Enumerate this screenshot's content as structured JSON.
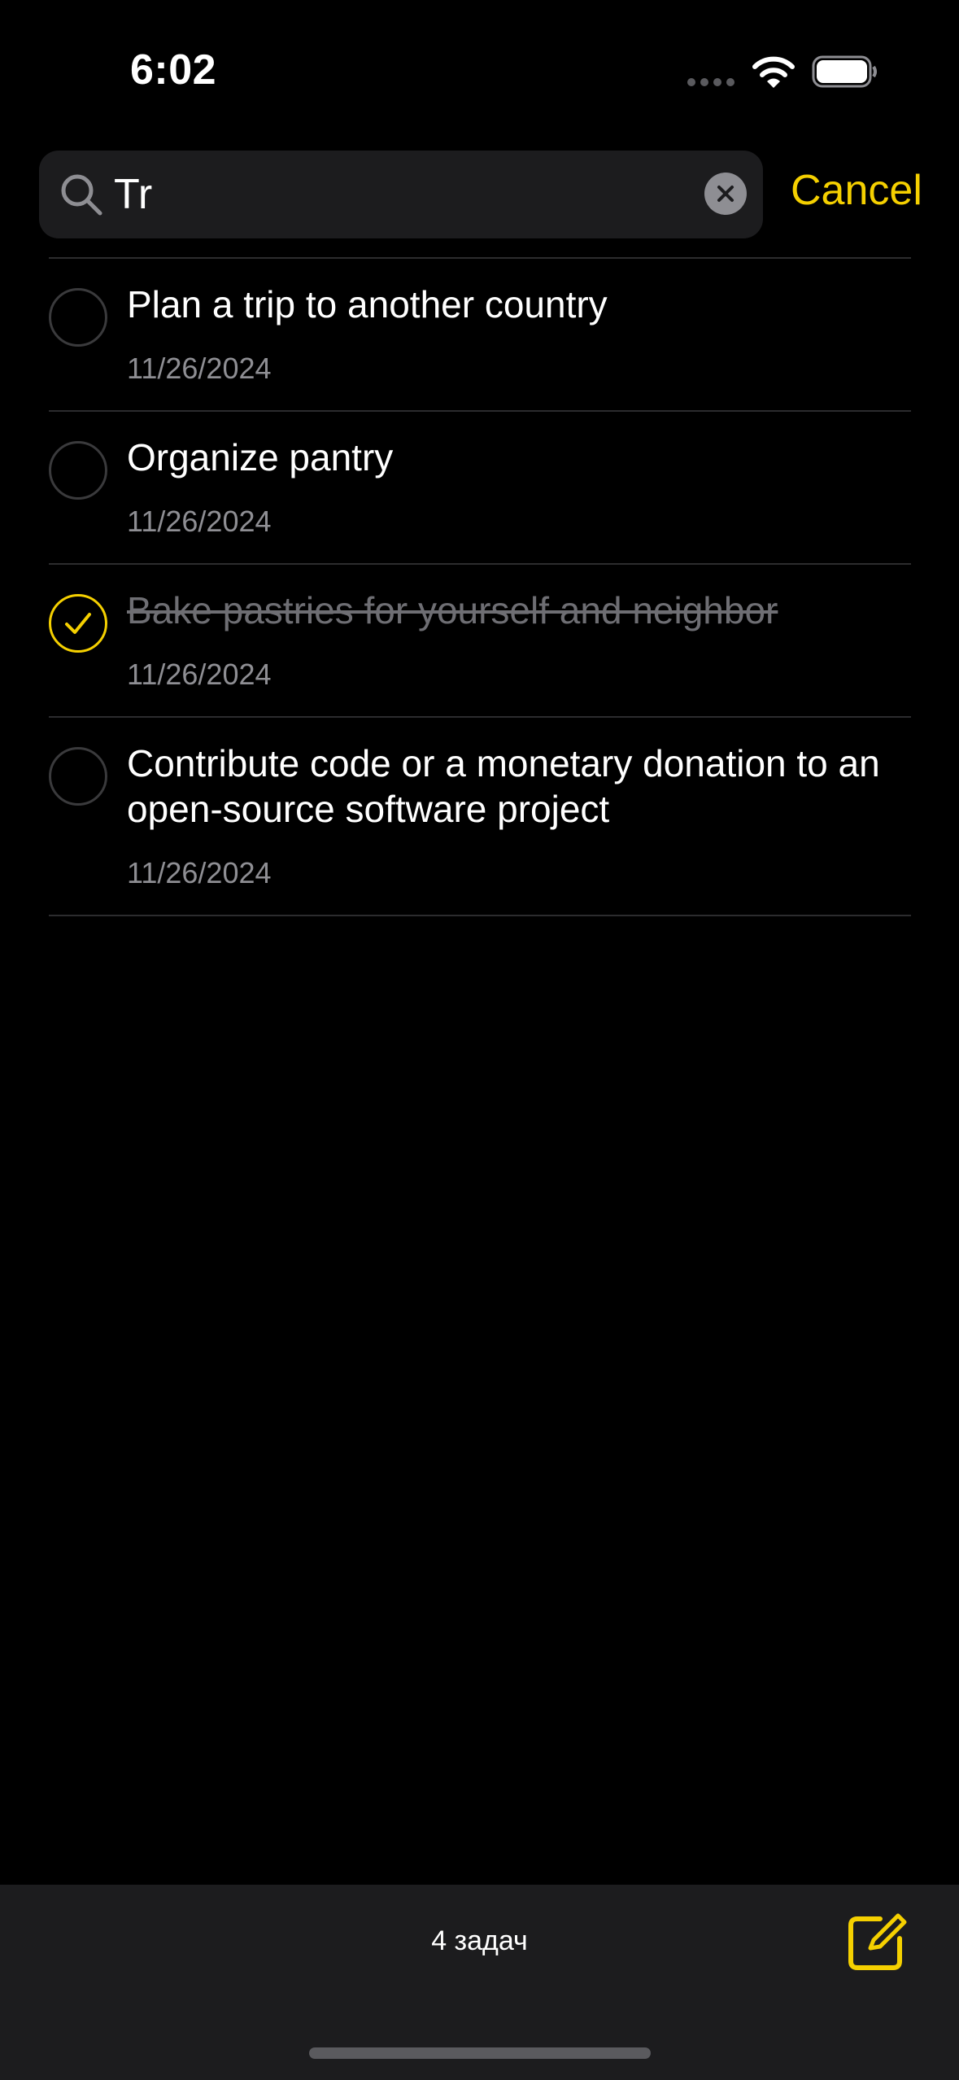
{
  "status_bar": {
    "time": "6:02",
    "icons": [
      "cellular-signal-icon",
      "wifi-icon",
      "battery-icon"
    ]
  },
  "search": {
    "value": "Tr",
    "cancel_label": "Cancel",
    "icons": [
      "search-icon",
      "clear-icon"
    ]
  },
  "tasks": [
    {
      "title": "Plan a trip to another country",
      "date": "11/26/2024",
      "completed": false
    },
    {
      "title": "Organize pantry",
      "date": "11/26/2024",
      "completed": false
    },
    {
      "title": "Bake pastries for yourself and neighbor",
      "date": "11/26/2024",
      "completed": true
    },
    {
      "title": "Contribute code or a monetary donation to an open-source software project",
      "date": "11/26/2024",
      "completed": false
    }
  ],
  "footer": {
    "task_count": "4 задач",
    "compose_icon": "compose-icon"
  },
  "colors": {
    "background": "#000000",
    "accent": "#f5d000",
    "surface": "#1c1c1e",
    "secondary_text": "#8e8e93",
    "separator": "#2c2c2e"
  }
}
